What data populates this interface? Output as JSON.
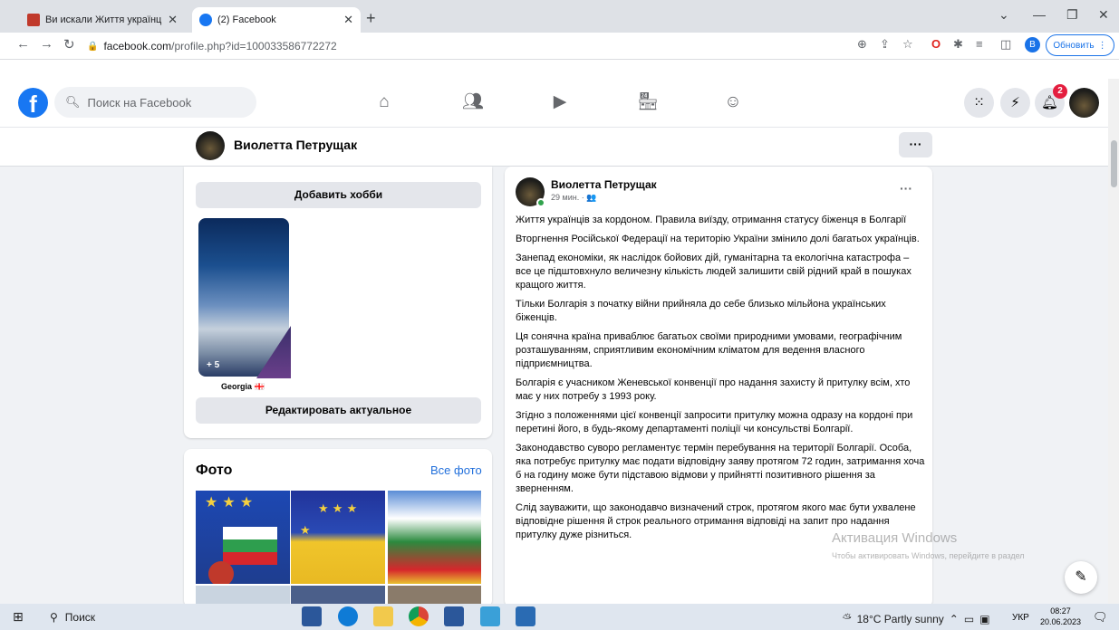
{
  "browser": {
    "tabs": [
      {
        "title": "Ви искали Життя українців за к",
        "active": false
      },
      {
        "title": "(2) Facebook",
        "active": true
      }
    ],
    "new_tab": "+",
    "close": "✕",
    "url_host": "facebook.com",
    "url_path": "/profile.php?id=100033586772272",
    "update_label": "Обновить",
    "profile_initial": "В"
  },
  "fb_header": {
    "logo": "f",
    "search_placeholder": "Поиск на Facebook",
    "notif_count": "2"
  },
  "profile": {
    "name": "Виолетта Петрущак",
    "more": "···"
  },
  "intro_card": {
    "add_hobby": "Добавить хобби",
    "story_count": "+ 5",
    "story_caption": "Georgia 🇬🇪",
    "edit_highlights": "Редактировать актуальное"
  },
  "photos_card": {
    "title": "Фото",
    "see_all": "Все фото"
  },
  "post": {
    "author": "Виолетта Петрущак",
    "time": "29 мин. · 👥",
    "more": "···",
    "paragraphs": [
      "Життя українців за кордоном. Правила виїзду, отримання статусу біженця в Болгарії",
      "Вторгнення Російської Федерації на територію України змінило долі багатьох українців.",
      "Занепад економіки, як наслідок бойових дій, гуманітарна та екологічна катастрофа – все це підштовхнуло величезну кількість людей залишити свій рідний край в пошуках кращого життя.",
      "Тільки Болгарія з початку війни прийняла до себе близько мільйона українських біженців.",
      "Ця сонячна країна приваблює багатьох своїми природними умовами, географічним розташуванням, сприятливим економічним кліматом для ведення власного підприємництва.",
      "Болгарія є учасником Женевської конвенції про надання захисту й притулку всім,  хто має у них потребу з 1993 року.",
      "Згідно з положеннями цієї конвенції запросити притулку можна одразу на кордоні при перетині його, в будь-якому департаменті поліції чи консульстві Болгарії.",
      "Законодавство суворо регламентує термін перебування на території Болгарії. Особа, яка потребує притулку має подати відповідну заяву протягом 72 годин, затримання хоча б на годину може бути підставою відмови у прийнятті позитивного рішення за зверненням.",
      "Слід зауважити, що законодавчо визначений строк, протягом якого має бути ухвалене відповідне рішення й строк реального отримання відповіді на запит про надання притулку дуже різниться."
    ]
  },
  "watermark": {
    "title": "Активация Windows",
    "subtitle": "Чтобы активировать Windows, перейдите в раздел"
  },
  "taskbar": {
    "search": "Поиск",
    "weather": "18°C  Partly sunny",
    "lang": "УКР",
    "time": "08:27",
    "date": "20.06.2023"
  }
}
